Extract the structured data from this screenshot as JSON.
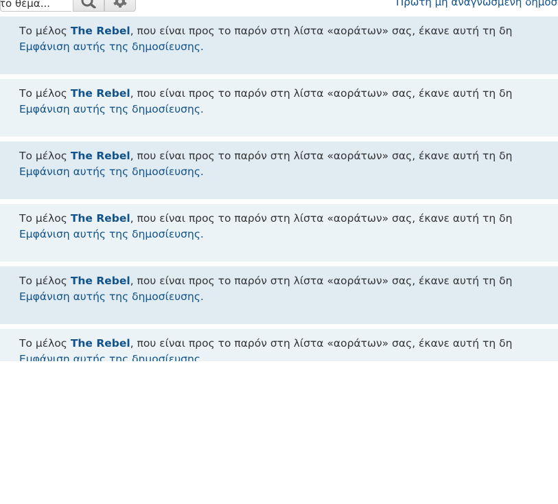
{
  "toolbar": {
    "search_placeholder": "το θέμα...",
    "search_icon": "search-icon",
    "settings_icon": "gear-icon",
    "first_unread_link": "Πρώτη μη αναγνωσμένη δημοσίευση"
  },
  "colors": {
    "post_dark_bg": "#e1ebf2",
    "post_light_bg": "#ecf3f7",
    "link": "#105289",
    "text": "#333333"
  },
  "posts": [
    {
      "prefix": "Το μέλος ",
      "member": "The Rebel",
      "suffix": ", που είναι προς το παρόν στη λίστα «αοράτων» σας, έκανε αυτή τη δη",
      "show_link": "Εμφάνιση αυτής της δημοσίευσης."
    },
    {
      "prefix": "Το μέλος ",
      "member": "The Rebel",
      "suffix": ", που είναι προς το παρόν στη λίστα «αοράτων» σας, έκανε αυτή τη δη",
      "show_link": "Εμφάνιση αυτής της δημοσίευσης."
    },
    {
      "prefix": "Το μέλος ",
      "member": "The Rebel",
      "suffix": ", που είναι προς το παρόν στη λίστα «αοράτων» σας, έκανε αυτή τη δη",
      "show_link": "Εμφάνιση αυτής της δημοσίευσης."
    },
    {
      "prefix": "Το μέλος ",
      "member": "The Rebel",
      "suffix": ", που είναι προς το παρόν στη λίστα «αοράτων» σας, έκανε αυτή τη δη",
      "show_link": "Εμφάνιση αυτής της δημοσίευσης."
    },
    {
      "prefix": "Το μέλος ",
      "member": "The Rebel",
      "suffix": ", που είναι προς το παρόν στη λίστα «αοράτων» σας, έκανε αυτή τη δη",
      "show_link": "Εμφάνιση αυτής της δημοσίευσης."
    },
    {
      "prefix": "Το μέλος ",
      "member": "The Rebel",
      "suffix": ", που είναι προς το παρόν στη λίστα «αοράτων» σας, έκανε αυτή τη δη",
      "show_link": "Εμφάνιση αυτής της δημοσίευσης."
    }
  ]
}
